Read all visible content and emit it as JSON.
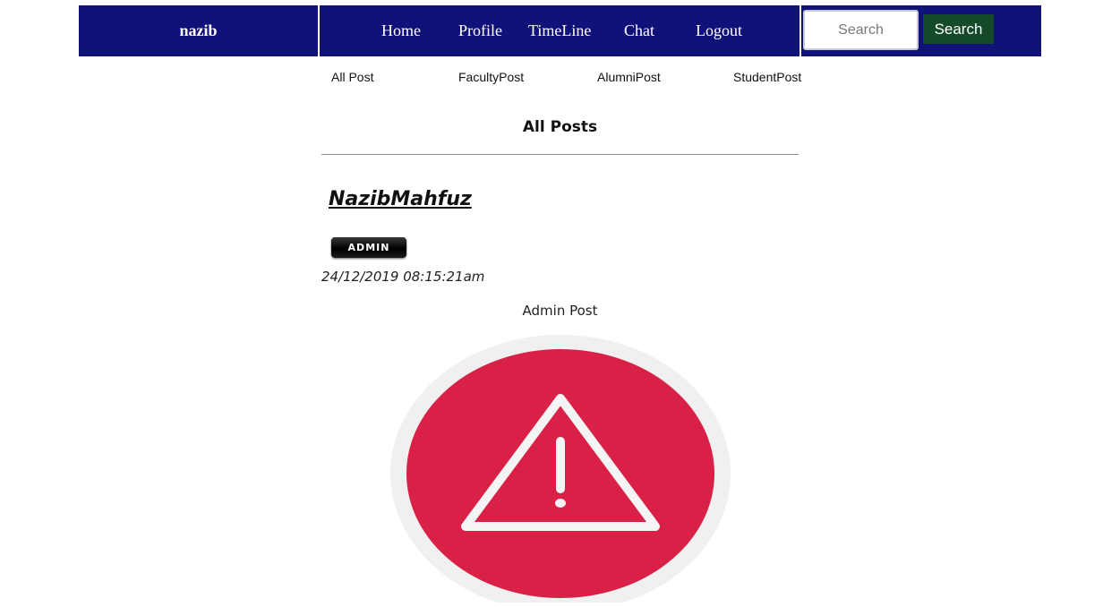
{
  "brand": "nazib",
  "nav": {
    "home": "Home",
    "profile": "Profile",
    "timeline": "TimeLine",
    "chat": "Chat",
    "logout": "Logout"
  },
  "search": {
    "placeholder": "Search",
    "button_label": "Search"
  },
  "subtabs": {
    "all": "All Post",
    "faculty": "FacultyPost",
    "alumni": "AlumniPost",
    "student": "StudentPost"
  },
  "section_title": "All Posts",
  "post": {
    "author": "NazibMahfuz",
    "badge": "ADMIN",
    "timestamp": "24/12/2019 08:15:21am",
    "text": "Admin Post",
    "image_icon": "warning-icon"
  },
  "colors": {
    "navbar": "#11117a",
    "search_button": "#144a2a",
    "warning_circle": "#d92147",
    "warning_ring": "#f0f0f0"
  }
}
